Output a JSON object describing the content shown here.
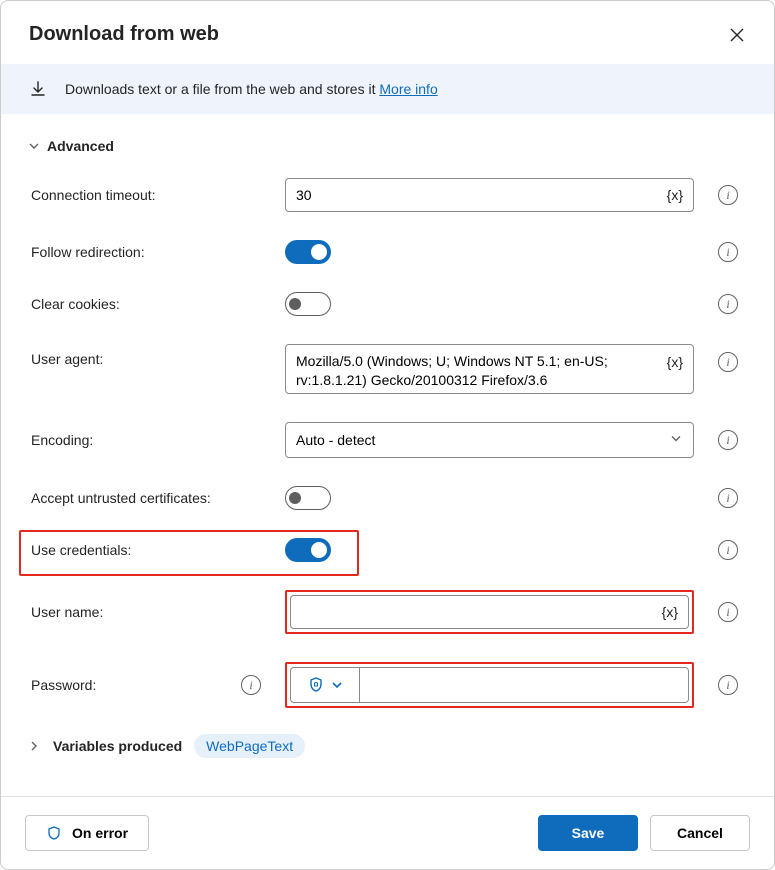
{
  "header": {
    "title": "Download from web"
  },
  "infoBar": {
    "text": "Downloads text or a file from the web and stores it ",
    "link": "More info"
  },
  "advanced": {
    "label": "Advanced"
  },
  "fields": {
    "connTimeout": {
      "label": "Connection timeout:",
      "value": "30",
      "varToken": "{x}"
    },
    "followRedirect": {
      "label": "Follow redirection:",
      "on": true
    },
    "clearCookies": {
      "label": "Clear cookies:",
      "on": false
    },
    "userAgent": {
      "label": "User agent:",
      "value": "Mozilla/5.0 (Windows; U; Windows NT 5.1; en-US; rv:1.8.1.21) Gecko/20100312 Firefox/3.6",
      "varToken": "{x}"
    },
    "encoding": {
      "label": "Encoding:",
      "value": "Auto - detect"
    },
    "acceptUntrusted": {
      "label": "Accept untrusted certificates:",
      "on": false
    },
    "useCredentials": {
      "label": "Use credentials:",
      "on": true
    },
    "userName": {
      "label": "User name:",
      "value": "",
      "varToken": "{x}"
    },
    "password": {
      "label": "Password:",
      "value": ""
    }
  },
  "variables": {
    "label": "Variables produced",
    "pill": "WebPageText"
  },
  "footer": {
    "onError": "On error",
    "save": "Save",
    "cancel": "Cancel"
  },
  "glyph": {
    "info": "i"
  }
}
